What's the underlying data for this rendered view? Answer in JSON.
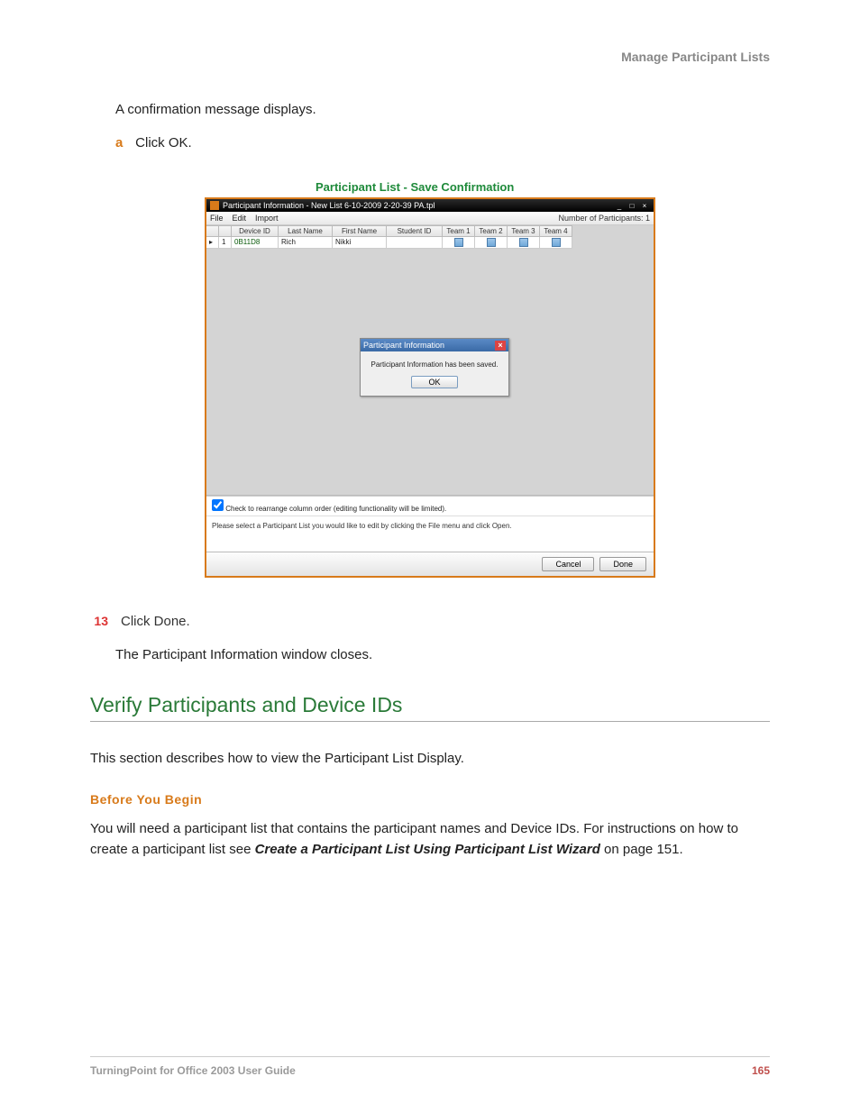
{
  "header": {
    "right": "Manage Participant Lists"
  },
  "intro": "A confirmation message displays.",
  "substep": {
    "letter": "a",
    "text": "Click OK."
  },
  "figure": {
    "caption": "Participant List - Save Confirmation"
  },
  "window": {
    "title": "Participant Information - New List 6-10-2009 2-20-39 PA.tpl",
    "menu": {
      "file": "File",
      "edit": "Edit",
      "import": "Import"
    },
    "count_label": "Number of Participants: 1",
    "columns": {
      "device_id": "Device ID",
      "last_name": "Last Name",
      "first_name": "First Name",
      "student_id": "Student ID",
      "team1": "Team 1",
      "team2": "Team 2",
      "team3": "Team 3",
      "team4": "Team 4"
    },
    "row": {
      "num": "1",
      "device_id": "0B11D8",
      "last_name": "Rich",
      "first_name": "Nikki",
      "student_id": ""
    },
    "dialog": {
      "title": "Participant Information",
      "message": "Participant Information has been saved.",
      "ok": "OK"
    },
    "checkbox_label": "Check to rearrange column order (editing functionality will be limited).",
    "instruction": "Please select a Participant List you would like to edit by clicking the File menu and click Open.",
    "buttons": {
      "cancel": "Cancel",
      "done": "Done"
    }
  },
  "step13": {
    "num": "13",
    "text": "Click Done.",
    "after": "The Participant Information window closes."
  },
  "section_heading": "Verify Participants and Device IDs",
  "section_intro": "This section describes how to view the Participant List Display.",
  "before_begin": "Before You Begin",
  "before_text_pre": "You will need a participant list that contains the participant names and Device IDs. For instructions on how to create a participant list see ",
  "before_text_ref": "Create a Participant List Using Participant List Wizard",
  "before_text_post": " on page 151.",
  "footer": {
    "left": "TurningPoint for Office 2003 User Guide",
    "page": "165"
  }
}
